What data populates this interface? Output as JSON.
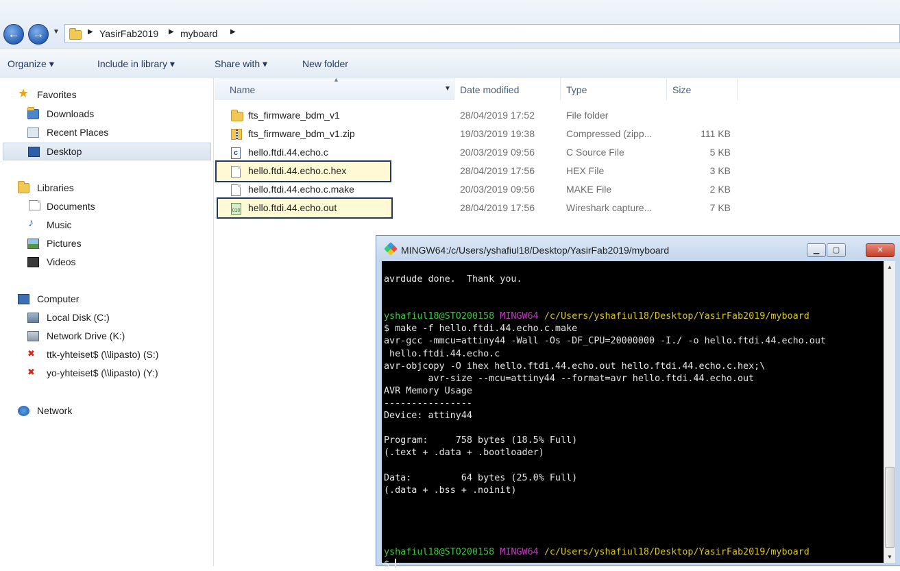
{
  "address": {
    "crumbs": [
      "YasirFab2019",
      "myboard"
    ]
  },
  "toolbar": {
    "organize": "Organize ▾",
    "include_in_library": "Include in library ▾",
    "share_with": "Share with ▾",
    "new_folder": "New folder"
  },
  "nav": {
    "favorites": "Favorites",
    "downloads": "Downloads",
    "recent_places": "Recent Places",
    "desktop": "Desktop",
    "libraries": "Libraries",
    "documents": "Documents",
    "music": "Music",
    "pictures": "Pictures",
    "videos": "Videos",
    "computer": "Computer",
    "local_disk": "Local Disk (C:)",
    "network_drive": "Network Drive (K:)",
    "ttk_share": "ttk-yhteiset$ (\\\\lipasto) (S:)",
    "yo_share": "yo-yhteiset$ (\\\\lipasto) (Y:)",
    "network": "Network"
  },
  "columns": {
    "name": "Name",
    "date": "Date modified",
    "type": "Type",
    "size": "Size"
  },
  "files": [
    {
      "name": "fts_firmware_bdm_v1",
      "date": "28/04/2019 17:52",
      "type": "File folder",
      "size": ""
    },
    {
      "name": "fts_firmware_bdm_v1.zip",
      "date": "19/03/2019 19:38",
      "type": "Compressed (zipp...",
      "size": "111 KB"
    },
    {
      "name": "hello.ftdi.44.echo.c",
      "date": "20/03/2019 09:56",
      "type": "C Source File",
      "size": "5 KB"
    },
    {
      "name": "hello.ftdi.44.echo.c.hex",
      "date": "28/04/2019 17:56",
      "type": "HEX File",
      "size": "3 KB"
    },
    {
      "name": "hello.ftdi.44.echo.c.make",
      "date": "20/03/2019 09:56",
      "type": "MAKE File",
      "size": "2 KB"
    },
    {
      "name": "hello.ftdi.44.echo.out",
      "date": "28/04/2019 17:56",
      "type": "Wireshark capture...",
      "size": "7 KB"
    }
  ],
  "terminal": {
    "title": "MINGW64:/c/Users/yshafiul18/Desktop/YasirFab2019/myboard",
    "l1": "avrdude done.  Thank you.",
    "user": "yshafiul18@STO200158",
    "env": "MINGW64",
    "path": "/c/Users/yshafiul18/Desktop/YasirFab2019/myboard",
    "cmd": "$ make -f hello.ftdi.44.echo.c.make",
    "l2": "avr-gcc -mmcu=attiny44 -Wall -Os -DF_CPU=20000000 -I./ -o hello.ftdi.44.echo.out",
    "l3": " hello.ftdi.44.echo.c",
    "l4": "avr-objcopy -O ihex hello.ftdi.44.echo.out hello.ftdi.44.echo.c.hex;\\",
    "l5": "        avr-size --mcu=attiny44 --format=avr hello.ftdi.44.echo.out",
    "l6": "AVR Memory Usage",
    "l7": "----------------",
    "l8": "Device: attiny44",
    "l9": "Program:     758 bytes (18.5% Full)",
    "l10": "(.text + .data + .bootloader)",
    "l11": "Data:         64 bytes (25.0% Full)",
    "l12": "(.data + .bss + .noinit)",
    "prompt": "$ "
  }
}
